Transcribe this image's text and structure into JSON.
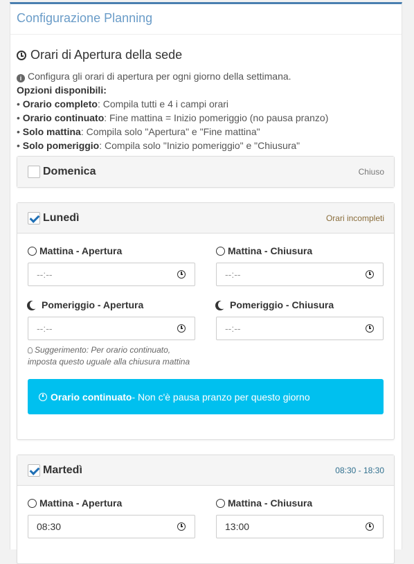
{
  "panel": {
    "title": "Configurazione Planning"
  },
  "section": {
    "title": "Orari di Apertura della sede"
  },
  "info": {
    "intro": "Configura gli orari di apertura per ogni giorno della settimana.",
    "options_heading": "Opzioni disponibili:",
    "options": [
      {
        "bullet": "•",
        "name": "Orario completo",
        "desc": ": Compila tutti e 4 i campi orari"
      },
      {
        "bullet": "•",
        "name": "Orario continuato",
        "desc": ": Fine mattina = Inizio pomeriggio (no pausa pranzo)"
      },
      {
        "bullet": "•",
        "name": "Solo mattina",
        "desc": ": Compila solo \"Apertura\" e \"Fine mattina\""
      },
      {
        "bullet": "•",
        "name": "Solo pomeriggio",
        "desc": ": Compila solo \"Inizio pomeriggio\" e \"Chiusura\""
      }
    ]
  },
  "labels": {
    "morning_open": "Mattina - Apertura",
    "morning_close": "Mattina - Chiusura",
    "afternoon_open": "Pomeriggio - Apertura",
    "afternoon_close": "Pomeriggio - Chiusura"
  },
  "days": [
    {
      "name": "Domenica",
      "status": "Chiuso",
      "checked": false
    },
    {
      "name": "Lunedì",
      "status": "Orari incompleti",
      "checked": true,
      "morning_open": "--:--",
      "morning_close": "--:--",
      "afternoon_open": "--:--",
      "afternoon_close": "--:--",
      "hint": "Suggerimento: Per orario continuato, imposta questo uguale alla chiusura mattina",
      "alert_bold": "Orario continuato",
      "alert_text": " - Non c'è pausa pranzo per questo giorno"
    },
    {
      "name": "Martedì",
      "status": "08:30 - 18:30",
      "checked": true,
      "morning_open": "08:30",
      "morning_close": "13:00"
    }
  ],
  "colors": {
    "accent": "#4a7fb0",
    "alert": "#00c0ef",
    "warn": "#8a6d3b",
    "ok": "#31708f"
  }
}
